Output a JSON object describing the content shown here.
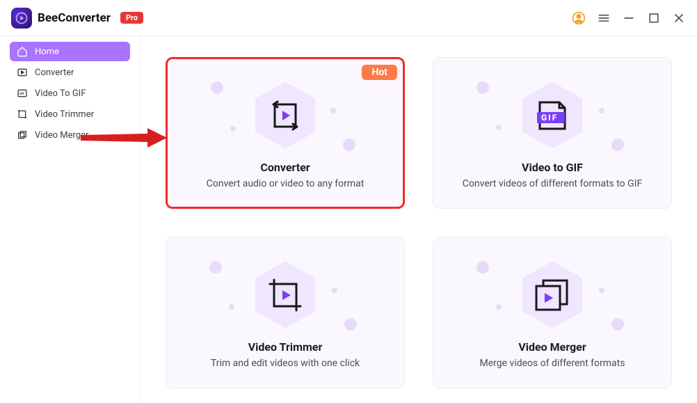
{
  "app": {
    "name": "BeeConverter",
    "pro_badge": "Pro"
  },
  "sidebar": {
    "items": [
      {
        "label": "Home",
        "active": true
      },
      {
        "label": "Converter",
        "active": false
      },
      {
        "label": "Video To GIF",
        "active": false
      },
      {
        "label": "Video Trimmer",
        "active": false
      },
      {
        "label": "Video Merger",
        "active": false
      }
    ]
  },
  "cards": {
    "converter": {
      "title": "Converter",
      "desc": "Convert audio or video to any format",
      "badge": "Hot"
    },
    "video_to_gif": {
      "title": "Video to GIF",
      "desc": "Convert videos of different formats to GIF",
      "gif_label": "GIF"
    },
    "video_trimmer": {
      "title": "Video Trimmer",
      "desc": "Trim and edit videos with one click"
    },
    "video_merger": {
      "title": "Video Merger",
      "desc": "Merge videos of different formats"
    }
  }
}
